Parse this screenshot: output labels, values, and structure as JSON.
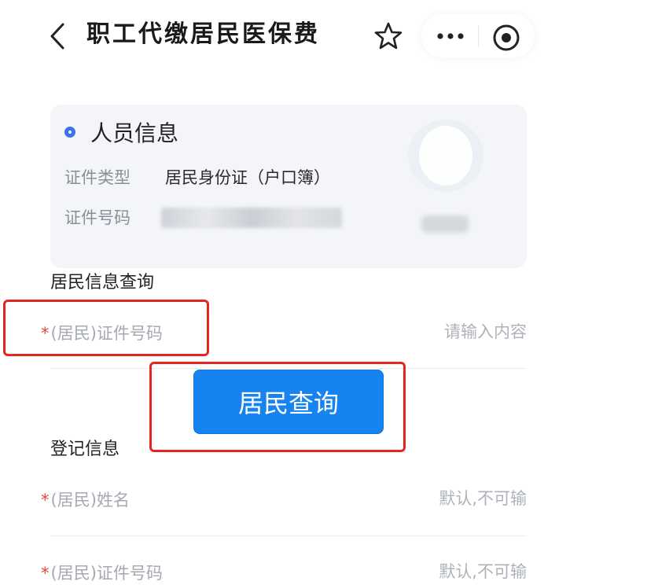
{
  "header": {
    "title": "职工代缴居民医保费",
    "back_icon": "chevron-left-icon",
    "favorite_icon": "star-icon",
    "more_icon": "more-dots-icon",
    "close_icon": "target-icon"
  },
  "person_card": {
    "title": "人员信息",
    "id_type_label": "证件类型",
    "id_type_value": "居民身份证（户口簿）",
    "id_number_label": "证件号码"
  },
  "resident_query": {
    "section_title": "居民信息查询",
    "id_field": {
      "required_mark": "*",
      "label": "(居民)证件号码",
      "placeholder": "请输入内容"
    },
    "button_label": "居民查询"
  },
  "registration": {
    "section_title": "登记信息",
    "fields": [
      {
        "required_mark": "*",
        "label": "(居民)姓名",
        "placeholder": "默认,不可输"
      },
      {
        "required_mark": "*",
        "label": "(居民)证件号码",
        "placeholder": "默认,不可输"
      }
    ]
  },
  "colors": {
    "accent_blue": "#1683f0",
    "highlight_red": "#e3261f",
    "required_red": "#e04a3c",
    "card_bg": "#f3f5f9"
  }
}
